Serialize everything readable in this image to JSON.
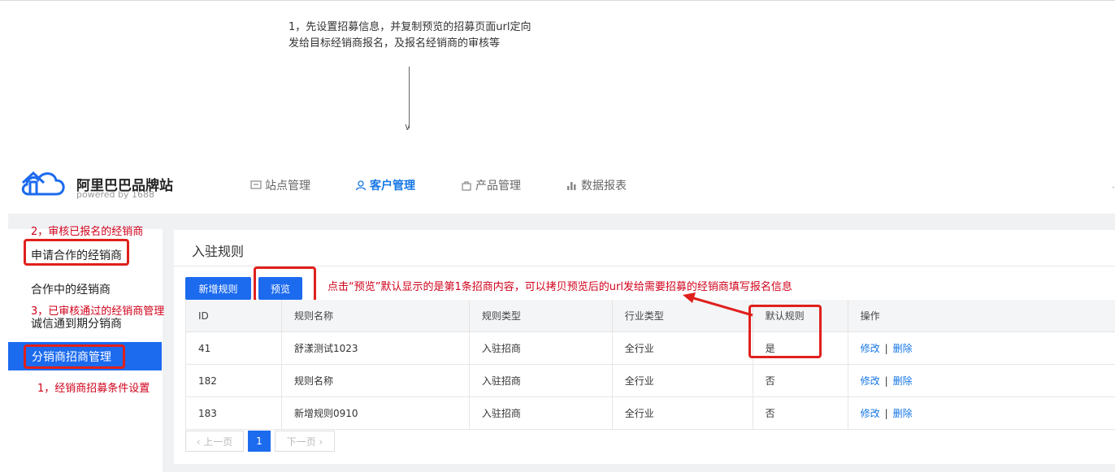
{
  "annotations": {
    "top_line1": "1，先设置招募信息，并复制预览的招募页面url定向",
    "top_line2": "发给目标经销商报名，及报名经销商的审核等",
    "step2": "2，审核已报名的经销商",
    "step3": "3，已审核通过的经销商管理",
    "step1": "1，经销商招募条件设置",
    "preview_note": "点击“预览”默认显示的是第1条招商内容，可以拷贝预览后的url发给需要招募的经销商填写报名信息"
  },
  "header": {
    "brand": "阿里巴巴品牌站",
    "brand_sub": "powered by 1688",
    "nav": [
      {
        "label": "站点管理",
        "icon": "monitor-icon"
      },
      {
        "label": "客户管理",
        "icon": "user-icon",
        "active": true
      },
      {
        "label": "产品管理",
        "icon": "bag-icon"
      },
      {
        "label": "数据报表",
        "icon": "bar-chart-icon"
      }
    ]
  },
  "sidebar": {
    "items": [
      {
        "label": "申请合作的经销商"
      },
      {
        "label": "合作中的经销商"
      },
      {
        "label": "诚信通到期分销商"
      },
      {
        "label": "分销商招商管理",
        "active": true
      }
    ]
  },
  "panel": {
    "title": "入驻规则",
    "add_button": "新增规则",
    "preview_button": "预览"
  },
  "table": {
    "headers": [
      "ID",
      "规则名称",
      "规则类型",
      "行业类型",
      "默认规则",
      "操作"
    ],
    "rows": [
      {
        "id": "41",
        "name": "舒漾测试1023",
        "type": "入驻招商",
        "industry": "全行业",
        "default": "是",
        "edit": "修改",
        "sep": "|",
        "delete": "删除"
      },
      {
        "id": "182",
        "name": "规则名称",
        "type": "入驻招商",
        "industry": "全行业",
        "default": "否",
        "edit": "修改",
        "sep": "|",
        "delete": "删除"
      },
      {
        "id": "183",
        "name": "新增规则0910",
        "type": "入驻招商",
        "industry": "全行业",
        "default": "否",
        "edit": "修改",
        "sep": "|",
        "delete": "删除"
      }
    ]
  },
  "pagination": {
    "prev": "‹ 上一页",
    "current": "1",
    "next": "下一页 ›"
  },
  "colors": {
    "primary": "#1c6bef",
    "annotation_red": "#d0021b",
    "link": "#1677e5"
  }
}
